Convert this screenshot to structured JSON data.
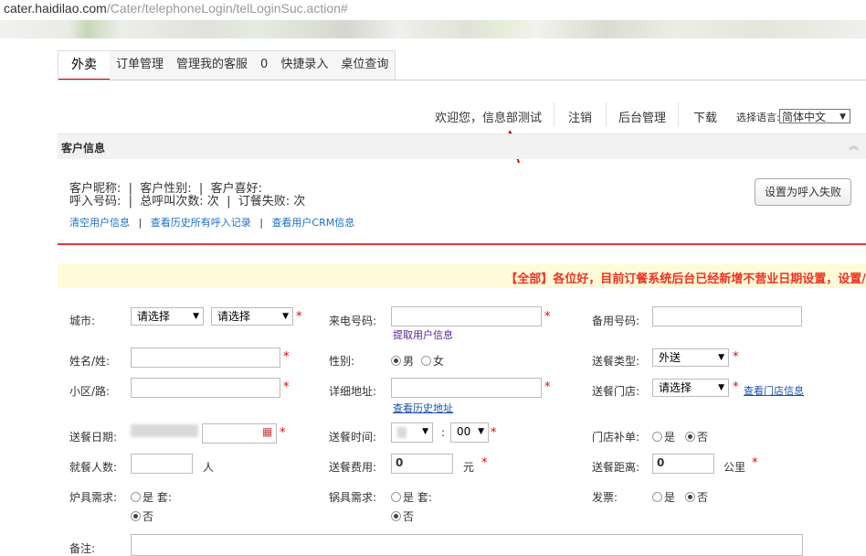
{
  "url": {
    "host": "cater.haidilao.com",
    "path": "/Cater/telephoneLogin/telLoginSuc.action#"
  },
  "tabs": [
    "外卖",
    "订单管理",
    "管理我的客服",
    "0",
    "快捷录入",
    "桌位查询"
  ],
  "topnav": {
    "welcome": "欢迎您，信息部测试",
    "logout": "注销",
    "admin": "后台管理",
    "download": "下载",
    "lang_label": "选择语言:",
    "lang_value": "简体中文"
  },
  "customer": {
    "title": "客户信息",
    "line1": "客户昵称:  |  客户性别:  |  客户喜好:",
    "line2": "呼入号码:  |  总呼叫次数: 次  |  订餐失败: 次",
    "links": [
      "清空用户信息",
      "查看历史所有呼入记录",
      "查看用户CRM信息"
    ],
    "fail_button": "设置为呼入失败"
  },
  "notice": "【全部】各位好，目前订餐系统后台已经新增不营业日期设置，设置/",
  "form": {
    "city_label": "城市:",
    "city_sel1": "请选择",
    "city_sel2": "请选择",
    "caller_label": "来电号码:",
    "fetch_user": "提取用户信息",
    "backup_label": "备用号码:",
    "name_label": "姓名/姓:",
    "gender_label": "性别:",
    "male": "男",
    "female": "女",
    "delivery_type_label": "送餐类型:",
    "delivery_type_value": "外送",
    "district_label": "小区/路:",
    "address_label": "详细地址:",
    "history_address": "查看历史地址",
    "store_label": "送餐门店:",
    "store_value": "请选择",
    "store_info": "查看门店信息",
    "date_label": "送餐日期:",
    "time_label": "送餐时间:",
    "time_colon": ":",
    "minute_value": "00",
    "store_supp_label": "门店补单:",
    "yes": "是",
    "no": "否",
    "diners_label": "就餐人数:",
    "diners_unit": "人",
    "fee_label": "送餐费用:",
    "fee_value": "0",
    "fee_unit": "元",
    "distance_label": "送餐距离:",
    "distance_value": "0",
    "distance_unit": "公里",
    "stove_label": "炉具需求:",
    "set_unit": "套:",
    "pot_label": "锅具需求:",
    "invoice_label": "发票:",
    "remark_label": "备注:",
    "required_mark": "*"
  },
  "colors": {
    "accent_red": "#e32",
    "link_blue": "#1a6fc8",
    "notice_bg": "#fffbd9"
  }
}
